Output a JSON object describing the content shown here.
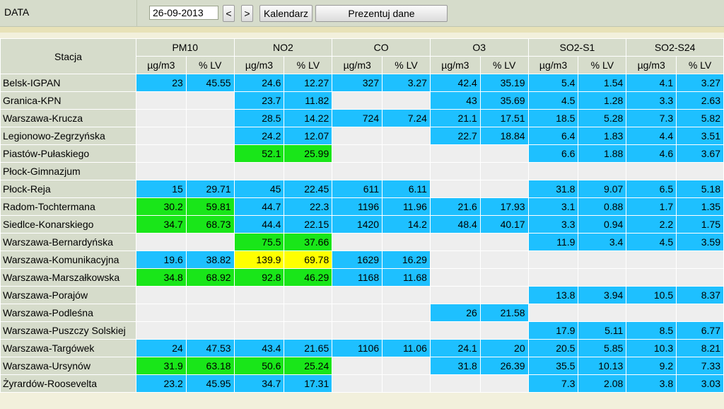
{
  "toolbar": {
    "date_label": "DATA",
    "date_value": "26-09-2013",
    "prev_label": "<",
    "next_label": ">",
    "calendar_label": "Kalendarz",
    "present_label": "Prezentuj dane"
  },
  "table": {
    "station_header": "Stacja",
    "pollutants": [
      "PM10",
      "NO2",
      "CO",
      "O3",
      "SO2-S1",
      "SO2-S24"
    ],
    "units": [
      "µg/m3",
      "% LV"
    ],
    "colors": {
      "b": "#1ec0ff",
      "g": "#19e619",
      "y": "#ffff00",
      "e": "#eeeeee"
    },
    "rows": [
      {
        "station": "Belsk-IGPAN",
        "cells": [
          [
            "23",
            "b"
          ],
          [
            "45.55",
            "b"
          ],
          [
            "24.6",
            "b"
          ],
          [
            "12.27",
            "b"
          ],
          [
            "327",
            "b"
          ],
          [
            "3.27",
            "b"
          ],
          [
            "42.4",
            "b"
          ],
          [
            "35.19",
            "b"
          ],
          [
            "5.4",
            "b"
          ],
          [
            "1.54",
            "b"
          ],
          [
            "4.1",
            "b"
          ],
          [
            "3.27",
            "b"
          ]
        ]
      },
      {
        "station": "Granica-KPN",
        "cells": [
          [
            "",
            "e"
          ],
          [
            "",
            "e"
          ],
          [
            "23.7",
            "b"
          ],
          [
            "11.82",
            "b"
          ],
          [
            "",
            "e"
          ],
          [
            "",
            "e"
          ],
          [
            "43",
            "b"
          ],
          [
            "35.69",
            "b"
          ],
          [
            "4.5",
            "b"
          ],
          [
            "1.28",
            "b"
          ],
          [
            "3.3",
            "b"
          ],
          [
            "2.63",
            "b"
          ]
        ]
      },
      {
        "station": "Warszawa-Krucza",
        "cells": [
          [
            "",
            "e"
          ],
          [
            "",
            "e"
          ],
          [
            "28.5",
            "b"
          ],
          [
            "14.22",
            "b"
          ],
          [
            "724",
            "b"
          ],
          [
            "7.24",
            "b"
          ],
          [
            "21.1",
            "b"
          ],
          [
            "17.51",
            "b"
          ],
          [
            "18.5",
            "b"
          ],
          [
            "5.28",
            "b"
          ],
          [
            "7.3",
            "b"
          ],
          [
            "5.82",
            "b"
          ]
        ]
      },
      {
        "station": "Legionowo-Zegrzyńska",
        "cells": [
          [
            "",
            "e"
          ],
          [
            "",
            "e"
          ],
          [
            "24.2",
            "b"
          ],
          [
            "12.07",
            "b"
          ],
          [
            "",
            "e"
          ],
          [
            "",
            "e"
          ],
          [
            "22.7",
            "b"
          ],
          [
            "18.84",
            "b"
          ],
          [
            "6.4",
            "b"
          ],
          [
            "1.83",
            "b"
          ],
          [
            "4.4",
            "b"
          ],
          [
            "3.51",
            "b"
          ]
        ]
      },
      {
        "station": "Piastów-Pułaskiego",
        "cells": [
          [
            "",
            "e"
          ],
          [
            "",
            "e"
          ],
          [
            "52.1",
            "g"
          ],
          [
            "25.99",
            "g"
          ],
          [
            "",
            "e"
          ],
          [
            "",
            "e"
          ],
          [
            "",
            "e"
          ],
          [
            "",
            "e"
          ],
          [
            "6.6",
            "b"
          ],
          [
            "1.88",
            "b"
          ],
          [
            "4.6",
            "b"
          ],
          [
            "3.67",
            "b"
          ]
        ]
      },
      {
        "station": "Płock-Gimnazjum",
        "cells": [
          [
            "",
            "e"
          ],
          [
            "",
            "e"
          ],
          [
            "",
            "e"
          ],
          [
            "",
            "e"
          ],
          [
            "",
            "e"
          ],
          [
            "",
            "e"
          ],
          [
            "",
            "e"
          ],
          [
            "",
            "e"
          ],
          [
            "",
            "e"
          ],
          [
            "",
            "e"
          ],
          [
            "",
            "e"
          ],
          [
            "",
            "e"
          ]
        ]
      },
      {
        "station": "Płock-Reja",
        "cells": [
          [
            "15",
            "b"
          ],
          [
            "29.71",
            "b"
          ],
          [
            "45",
            "b"
          ],
          [
            "22.45",
            "b"
          ],
          [
            "611",
            "b"
          ],
          [
            "6.11",
            "b"
          ],
          [
            "",
            "e"
          ],
          [
            "",
            "e"
          ],
          [
            "31.8",
            "b"
          ],
          [
            "9.07",
            "b"
          ],
          [
            "6.5",
            "b"
          ],
          [
            "5.18",
            "b"
          ]
        ]
      },
      {
        "station": "Radom-Tochtermana",
        "cells": [
          [
            "30.2",
            "g"
          ],
          [
            "59.81",
            "g"
          ],
          [
            "44.7",
            "b"
          ],
          [
            "22.3",
            "b"
          ],
          [
            "1196",
            "b"
          ],
          [
            "11.96",
            "b"
          ],
          [
            "21.6",
            "b"
          ],
          [
            "17.93",
            "b"
          ],
          [
            "3.1",
            "b"
          ],
          [
            "0.88",
            "b"
          ],
          [
            "1.7",
            "b"
          ],
          [
            "1.35",
            "b"
          ]
        ]
      },
      {
        "station": "Siedlce-Konarskiego",
        "cells": [
          [
            "34.7",
            "g"
          ],
          [
            "68.73",
            "g"
          ],
          [
            "44.4",
            "b"
          ],
          [
            "22.15",
            "b"
          ],
          [
            "1420",
            "b"
          ],
          [
            "14.2",
            "b"
          ],
          [
            "48.4",
            "b"
          ],
          [
            "40.17",
            "b"
          ],
          [
            "3.3",
            "b"
          ],
          [
            "0.94",
            "b"
          ],
          [
            "2.2",
            "b"
          ],
          [
            "1.75",
            "b"
          ]
        ]
      },
      {
        "station": "Warszawa-Bernardyńska",
        "cells": [
          [
            "",
            "e"
          ],
          [
            "",
            "e"
          ],
          [
            "75.5",
            "g"
          ],
          [
            "37.66",
            "g"
          ],
          [
            "",
            "e"
          ],
          [
            "",
            "e"
          ],
          [
            "",
            "e"
          ],
          [
            "",
            "e"
          ],
          [
            "11.9",
            "b"
          ],
          [
            "3.4",
            "b"
          ],
          [
            "4.5",
            "b"
          ],
          [
            "3.59",
            "b"
          ]
        ]
      },
      {
        "station": "Warszawa-Komunikacyjna",
        "cells": [
          [
            "19.6",
            "b"
          ],
          [
            "38.82",
            "b"
          ],
          [
            "139.9",
            "y"
          ],
          [
            "69.78",
            "y"
          ],
          [
            "1629",
            "b"
          ],
          [
            "16.29",
            "b"
          ],
          [
            "",
            "e"
          ],
          [
            "",
            "e"
          ],
          [
            "",
            "e"
          ],
          [
            "",
            "e"
          ],
          [
            "",
            "e"
          ],
          [
            "",
            "e"
          ]
        ]
      },
      {
        "station": "Warszawa-Marszałkowska",
        "cells": [
          [
            "34.8",
            "g"
          ],
          [
            "68.92",
            "g"
          ],
          [
            "92.8",
            "g"
          ],
          [
            "46.29",
            "g"
          ],
          [
            "1168",
            "b"
          ],
          [
            "11.68",
            "b"
          ],
          [
            "",
            "e"
          ],
          [
            "",
            "e"
          ],
          [
            "",
            "e"
          ],
          [
            "",
            "e"
          ],
          [
            "",
            "e"
          ],
          [
            "",
            "e"
          ]
        ]
      },
      {
        "station": "Warszawa-Porajów",
        "cells": [
          [
            "",
            "e"
          ],
          [
            "",
            "e"
          ],
          [
            "",
            "e"
          ],
          [
            "",
            "e"
          ],
          [
            "",
            "e"
          ],
          [
            "",
            "e"
          ],
          [
            "",
            "e"
          ],
          [
            "",
            "e"
          ],
          [
            "13.8",
            "b"
          ],
          [
            "3.94",
            "b"
          ],
          [
            "10.5",
            "b"
          ],
          [
            "8.37",
            "b"
          ]
        ]
      },
      {
        "station": "Warszawa-Podleśna",
        "cells": [
          [
            "",
            "e"
          ],
          [
            "",
            "e"
          ],
          [
            "",
            "e"
          ],
          [
            "",
            "e"
          ],
          [
            "",
            "e"
          ],
          [
            "",
            "e"
          ],
          [
            "26",
            "b"
          ],
          [
            "21.58",
            "b"
          ],
          [
            "",
            "e"
          ],
          [
            "",
            "e"
          ],
          [
            "",
            "e"
          ],
          [
            "",
            "e"
          ]
        ]
      },
      {
        "station": "Warszawa-Puszczy Solskiej",
        "cells": [
          [
            "",
            "e"
          ],
          [
            "",
            "e"
          ],
          [
            "",
            "e"
          ],
          [
            "",
            "e"
          ],
          [
            "",
            "e"
          ],
          [
            "",
            "e"
          ],
          [
            "",
            "e"
          ],
          [
            "",
            "e"
          ],
          [
            "17.9",
            "b"
          ],
          [
            "5.11",
            "b"
          ],
          [
            "8.5",
            "b"
          ],
          [
            "6.77",
            "b"
          ]
        ]
      },
      {
        "station": "Warszawa-Targówek",
        "cells": [
          [
            "24",
            "b"
          ],
          [
            "47.53",
            "b"
          ],
          [
            "43.4",
            "b"
          ],
          [
            "21.65",
            "b"
          ],
          [
            "1106",
            "b"
          ],
          [
            "11.06",
            "b"
          ],
          [
            "24.1",
            "b"
          ],
          [
            "20",
            "b"
          ],
          [
            "20.5",
            "b"
          ],
          [
            "5.85",
            "b"
          ],
          [
            "10.3",
            "b"
          ],
          [
            "8.21",
            "b"
          ]
        ]
      },
      {
        "station": "Warszawa-Ursynów",
        "cells": [
          [
            "31.9",
            "g"
          ],
          [
            "63.18",
            "g"
          ],
          [
            "50.6",
            "g"
          ],
          [
            "25.24",
            "g"
          ],
          [
            "",
            "e"
          ],
          [
            "",
            "e"
          ],
          [
            "31.8",
            "b"
          ],
          [
            "26.39",
            "b"
          ],
          [
            "35.5",
            "b"
          ],
          [
            "10.13",
            "b"
          ],
          [
            "9.2",
            "b"
          ],
          [
            "7.33",
            "b"
          ]
        ]
      },
      {
        "station": "Żyrardów-Roosevelta",
        "cells": [
          [
            "23.2",
            "b"
          ],
          [
            "45.95",
            "b"
          ],
          [
            "34.7",
            "b"
          ],
          [
            "17.31",
            "b"
          ],
          [
            "",
            "e"
          ],
          [
            "",
            "e"
          ],
          [
            "",
            "e"
          ],
          [
            "",
            "e"
          ],
          [
            "7.3",
            "b"
          ],
          [
            "2.08",
            "b"
          ],
          [
            "3.8",
            "b"
          ],
          [
            "3.03",
            "b"
          ]
        ]
      }
    ]
  }
}
